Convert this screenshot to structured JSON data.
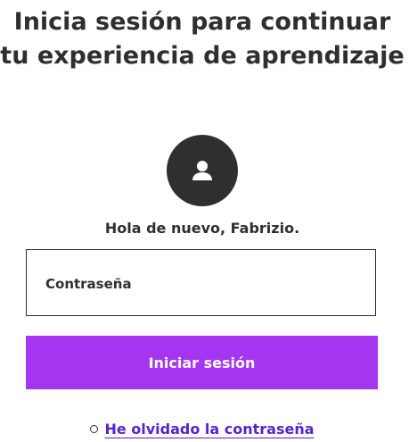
{
  "login": {
    "heading": "Inicia sesión para continuar tu experiencia de aprendizaje",
    "avatar_icon": "user-avatar-icon",
    "greeting": "Hola de nuevo, Fabrizio.",
    "password_label": "Contraseña",
    "password_value": "",
    "submit_label": "Iniciar sesión",
    "forgot_password_link": "He olvidado la contraseña"
  },
  "colors": {
    "text": "#2d2f31",
    "accent": "#a435f0",
    "link": "#5624d0",
    "avatar_bg": "#2d2f31"
  }
}
